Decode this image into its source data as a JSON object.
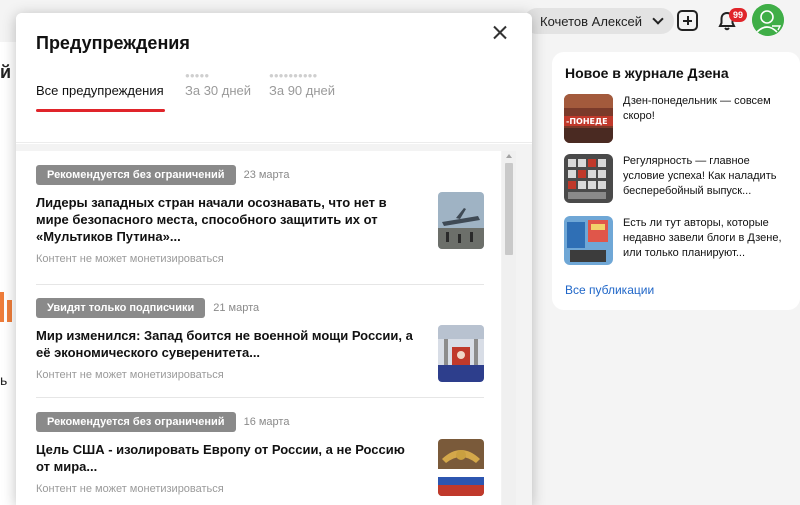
{
  "topbar": {
    "user_name": "Кочетов Алексей",
    "notifications_count": "99"
  },
  "left_fragment": {
    "text": "й",
    "small": "ь"
  },
  "side_panel": {
    "title": "Новое в журнале Дзена",
    "items": [
      {
        "text": "Дзен-понедельник — совсем скоро!"
      },
      {
        "text": "Регулярность — главное условие успеха! Как наладить бесперебойный выпуск..."
      },
      {
        "text": "Есть ли тут авторы, которые недавно завели блоги в Дзене, или только планируют..."
      }
    ],
    "link": "Все публикации"
  },
  "modal": {
    "title": "Предупреждения",
    "tabs": [
      {
        "label": "Все предупреждения",
        "dots": ""
      },
      {
        "label": "За 30 дней",
        "dots": "●●●●●"
      },
      {
        "label": "За 90 дней",
        "dots": "●●●●●●●●●●"
      }
    ],
    "articles": [
      {
        "tag": "Рекомендуется без ограничений",
        "date": "23 марта",
        "title": "Лидеры западных стран начали осознавать, что нет в мире безопасного места, способного защитить их от «Мультиков Путина»...",
        "note": "Контент не может монетизироваться"
      },
      {
        "tag": "Увидят только подписчики",
        "date": "21 марта",
        "title": "Мир изменился: Запад боится не военной мощи России, а её экономического суверенитета...",
        "note": "Контент не может монетизироваться"
      },
      {
        "tag": "Рекомендуется без ограничений",
        "date": "16 марта",
        "title": "Цель США - изолировать Европу от России, а не Россию от мира...",
        "note": "Контент не может монетизироваться"
      }
    ]
  },
  "colors": {
    "accent_red": "#e0242a",
    "tag_gray": "#8a8a8a",
    "link_blue": "#1f66c8"
  },
  "icons": [
    "plus-icon",
    "bell-icon",
    "chevron-down-icon",
    "close-icon",
    "avatar-icon"
  ]
}
